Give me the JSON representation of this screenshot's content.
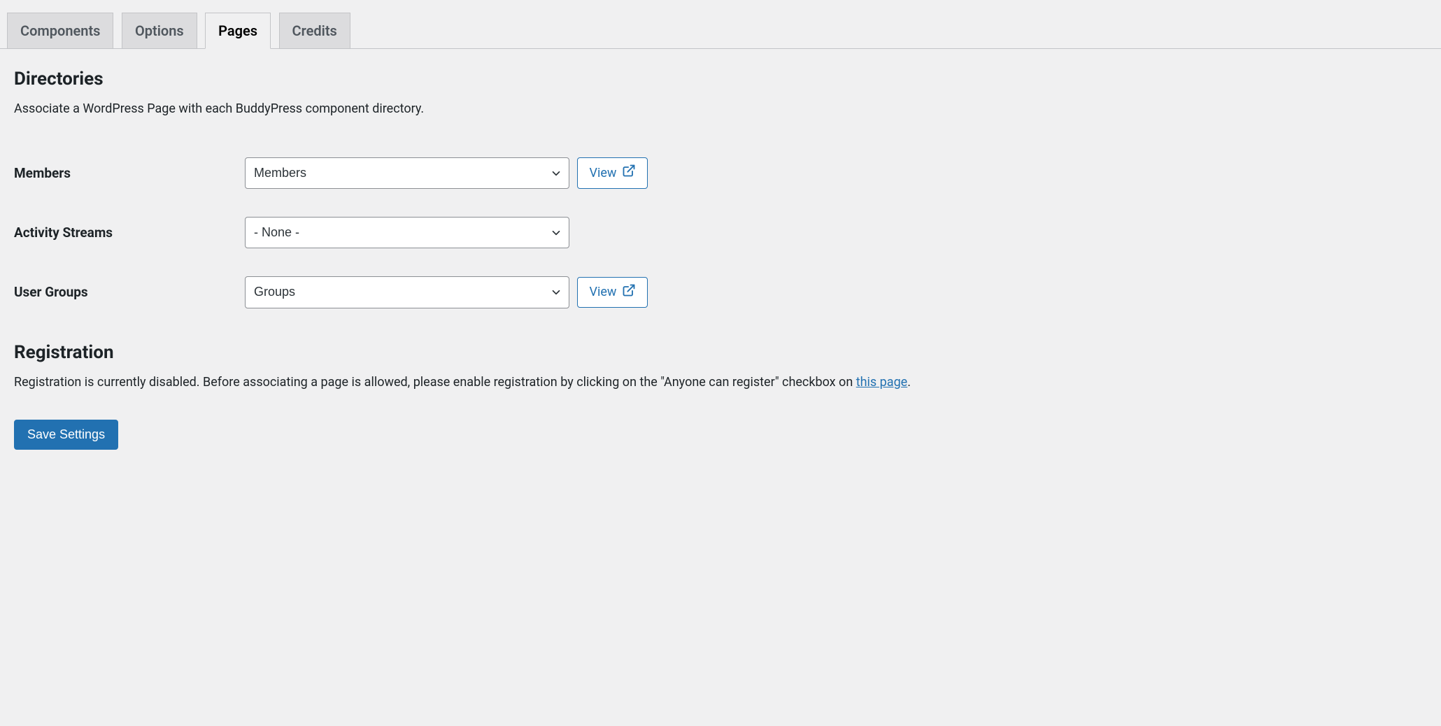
{
  "tabs": {
    "components": "Components",
    "options": "Options",
    "pages": "Pages",
    "credits": "Credits"
  },
  "directories": {
    "title": "Directories",
    "description": "Associate a WordPress Page with each BuddyPress component directory.",
    "rows": {
      "members": {
        "label": "Members",
        "selected": "Members",
        "view_label": "View",
        "has_view": true
      },
      "activity": {
        "label": "Activity Streams",
        "selected": "- None -",
        "has_view": false
      },
      "groups": {
        "label": "User Groups",
        "selected": "Groups",
        "view_label": "View",
        "has_view": true
      }
    }
  },
  "registration": {
    "title": "Registration",
    "disabled_text_pre": "Registration is currently disabled. Before associating a page is allowed, please enable registration by clicking on the \"Anyone can register\" checkbox on ",
    "link_text": "this page",
    "disabled_text_post": "."
  },
  "submit": {
    "label": "Save Settings"
  }
}
